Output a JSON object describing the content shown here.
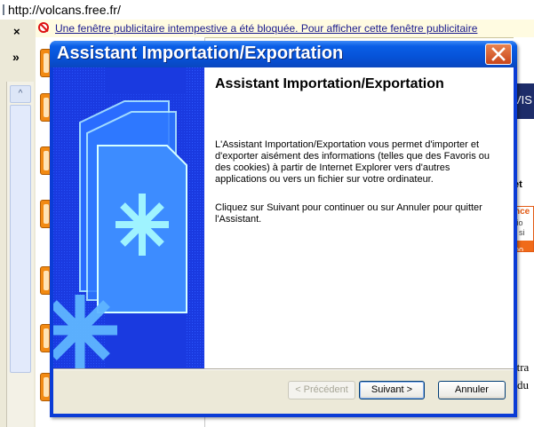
{
  "browser": {
    "address": "http://volcans.free.fr/",
    "close_glyph": "×",
    "expand_glyph": "»",
    "scroll_up_glyph": "^",
    "infobar_text": "Une fenêtre publicitaire intempestive a été bloquée. Pour afficher cette fenêtre publicitaire",
    "right_page": {
      "vis_text": "VIS",
      "et_text": "et",
      "box_line1": "nce",
      "box_line2": "tio",
      "box_line3": ", si",
      "box_bar": "oo",
      "text_ttr": "ttra",
      "text_du": "du"
    }
  },
  "dialog": {
    "title": "Assistant Importation/Exportation",
    "heading": "Assistant Importation/Exportation",
    "paragraph1": "L'Assistant Importation/Exportation vous permet d'importer et d'exporter aisément des informations (telles que des Favoris ou des cookies) à partir de Internet Explorer vers d'autres applications ou vers un fichier sur votre ordinateur.",
    "paragraph2": "Cliquez sur Suivant pour continuer ou sur Annuler pour quitter l'Assistant.",
    "buttons": {
      "previous": "< Précédent",
      "next": "Suivant >",
      "cancel": "Annuler"
    }
  },
  "colors": {
    "titlebar": "#0653d8",
    "wizard_blue": "#1a3ae0",
    "close_button": "#d9541e",
    "orange_accent": "#f28a13"
  },
  "icons": [
    "popup-blocked-icon",
    "close-icon",
    "wizard-folder-icon",
    "asterisk-icon"
  ]
}
